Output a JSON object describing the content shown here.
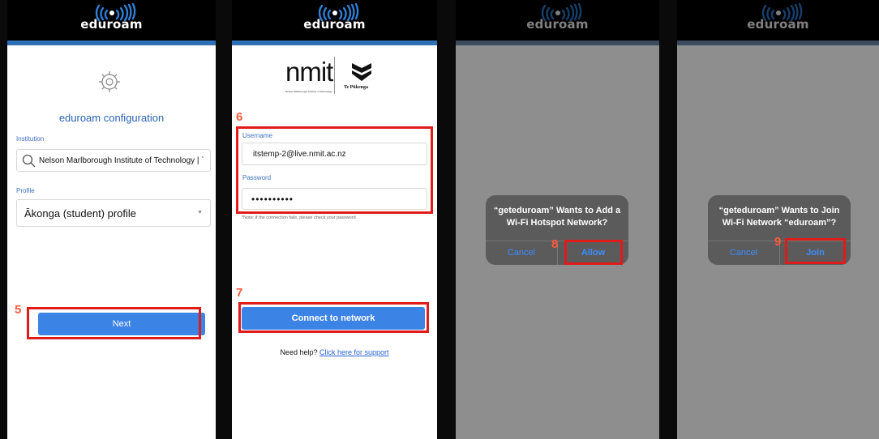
{
  "brand": {
    "logo_text": "eduroam",
    "accent_color": "#2f6fb8",
    "button_color": "#3c83e6",
    "highlight_color": "#e01b1b",
    "step_color": "#ff5a3a"
  },
  "screen1": {
    "icon": "gear-icon",
    "title": "eduroam configuration",
    "institution_label": "Institution",
    "institution_value": "Nelson Marlborough Institute of Technology | `",
    "profile_label": "Profile",
    "profile_value": "Ākonga (student) profile",
    "next_label": "Next",
    "step": "5"
  },
  "screen2": {
    "org_logo_text": "nmit",
    "org_logo_subtext": "Nelson Marlborough Institute of Technology",
    "partner_logo_text": "Te Pūkenga",
    "step_credentials": "6",
    "username_label": "Username",
    "username_value": "itstemp-2@live.nmit.ac.nz",
    "password_label": "Password",
    "password_value": "••••••••••",
    "note": "*Note: if the connection fails, please check your password",
    "step_connect": "7",
    "connect_label": "Connect to network",
    "help_text": "Need help?",
    "help_link": "Click here for support"
  },
  "screen3": {
    "dialog_line1": "“geteduroam” Wants to Add a",
    "dialog_line2": "Wi-Fi Hotspot Network?",
    "cancel_label": "Cancel",
    "confirm_label": "Allow",
    "step": "8"
  },
  "screen4": {
    "dialog_line1": "“geteduroam” Wants to Join",
    "dialog_line2": "Wi-Fi Network “eduroam”?",
    "cancel_label": "Cancel",
    "confirm_label": "Join",
    "step": "9"
  }
}
